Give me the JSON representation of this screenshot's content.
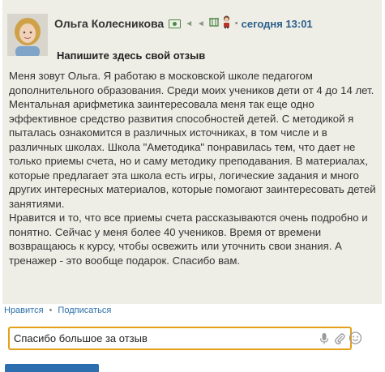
{
  "review": {
    "author": "Ольга Колесникова",
    "time": "сегодня 13:01",
    "separator": "•",
    "title": "Напишите здесь свой отзыв",
    "paragraphs": [
      "Меня зовут Ольга. Я работаю в московской школе педагогом дополнительного образования. Среди моих учеников дети от 4 до 14 лет. Ментальная арифметика заинтересовала меня так еще одно эффективное средство развития способностей детей. С методикой я пыталась ознакомится в различных источниках, в том числе и в различных школах. Школа \"Аметодика\" понравилась тем, что дает не только приемы счета, но и саму методику преподавания. В материалах, которые предлагает эта школа есть игры, логические задания и много других интересных материалов, которые помогают заинтересовать детей занятиями.",
      "Нравится и то, что все приемы счета рассказываются очень подробно и понятно. Сейчас у меня более 40 учеников. Время от времени возвращаюсь к курсу, чтобы освежить или уточнить свои знания. А тренажер - это вообще подарок. Спасибо вам."
    ]
  },
  "actions": {
    "like": "Нравится",
    "dot": "•",
    "subscribe": "Подписаться"
  },
  "comment": {
    "value": "Спасибо большое за отзыв"
  },
  "icons": {
    "avatar": "avatar-photo",
    "bill": "banknote-icon",
    "dots": "typing-dots-icon",
    "badge": "building-icon",
    "character": "avatar-badge-icon",
    "mic": "microphone-icon",
    "attach": "paperclip-icon",
    "emoji": "smiley-icon"
  },
  "colors": {
    "card_bg": "#eeeee6",
    "time": "#2a5f8c",
    "link": "#2a6fa8",
    "input_border": "#e4a019",
    "submit": "#2b6fb0"
  }
}
